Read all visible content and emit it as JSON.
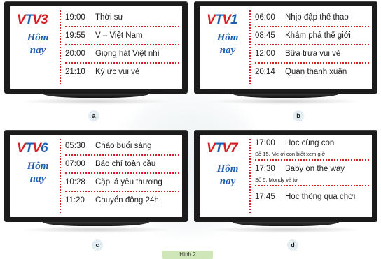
{
  "panels": [
    {
      "label": "a",
      "channel": "3",
      "today": [
        "Hôm",
        "nay"
      ],
      "schedule": [
        {
          "time": "19:00",
          "title": "Thời sự"
        },
        {
          "time": "19:55",
          "title": "V – Việt Nam"
        },
        {
          "time": "20:00",
          "title": "Giọng hát Việt nhí"
        },
        {
          "time": "21:10",
          "title": "Ký ức vui vẻ"
        }
      ]
    },
    {
      "label": "b",
      "channel": "1",
      "today": [
        "Hôm",
        "nay"
      ],
      "schedule": [
        {
          "time": "06:00",
          "title": "Nhịp đập thể thao"
        },
        {
          "time": "08:45",
          "title": "Khám phá thế giới"
        },
        {
          "time": "12:00",
          "title": "Bữa trưa vui vẻ"
        },
        {
          "time": "20:14",
          "title": "Quán thanh xuân"
        }
      ]
    },
    {
      "label": "c",
      "channel": "6",
      "today": [
        "Hôm",
        "nay"
      ],
      "schedule": [
        {
          "time": "05:30",
          "title": "Chào buổi sáng"
        },
        {
          "time": "07:00",
          "title": "Báo chí toàn cầu"
        },
        {
          "time": "10:28",
          "title": "Cặp lá yêu thương"
        },
        {
          "time": "11:20",
          "title": "Chuyển động 24h"
        }
      ]
    },
    {
      "label": "d",
      "channel": "7",
      "today": [
        "Hôm",
        "nay"
      ],
      "schedule": [
        {
          "time": "17:00",
          "title": "Học cùng con",
          "sub": "Số 15. Mẹ ơi con biết xem giờ"
        },
        {
          "time": "17:30",
          "title": "Baby on the way",
          "sub": "Số 5. Mondy và tớ"
        },
        {
          "time": "17:45",
          "title": "Học thông qua chơi"
        }
      ]
    }
  ],
  "logo_prefix": [
    "V",
    "T",
    "V"
  ],
  "caption": "Hình 2",
  "colors": {
    "red": "#d51f26",
    "blue": "#1f5fb0",
    "tv": "#1b1b1b"
  }
}
